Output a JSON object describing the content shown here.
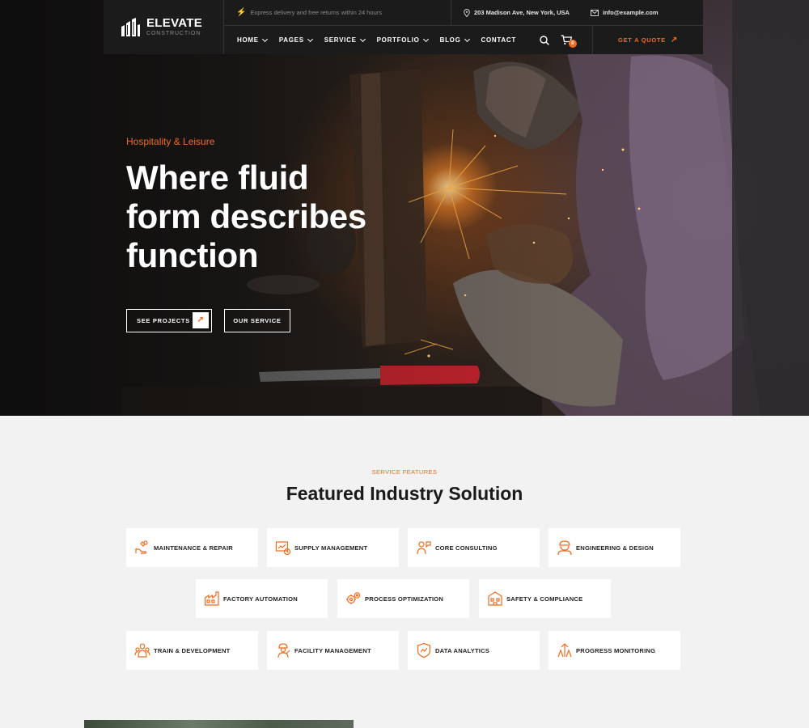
{
  "header": {
    "logo_name": "ELEVATE",
    "logo_sub": "CONSTRUCTION",
    "promo_text": "Express delivery and free returns within 24 hours",
    "address": "203 Madison Ave, New York, USA",
    "email": "info@example.com",
    "nav": [
      {
        "label": "HOME",
        "dropdown": true
      },
      {
        "label": "PAGES",
        "dropdown": true
      },
      {
        "label": "SERVICE",
        "dropdown": true
      },
      {
        "label": "PORTFOLIO",
        "dropdown": true
      },
      {
        "label": "BLOG",
        "dropdown": true
      },
      {
        "label": "CONTACT",
        "dropdown": false
      }
    ],
    "cart_count": "0",
    "quote_label": "GET A QUOTE"
  },
  "hero": {
    "kicker": "Hospitality & Leisure",
    "title_lines": [
      "Where fluid",
      "form describes",
      "function"
    ],
    "btn_projects": "SEE PROJECTS",
    "btn_service": "OUR SERVICE"
  },
  "services": {
    "kicker": "SERVICE FEATURES",
    "title": "Featured Industry Solution",
    "items": [
      {
        "label": "MAINTENANCE & REPAIR",
        "icon": "wrench-hand-icon"
      },
      {
        "label": "SUPPLY MANAGEMENT",
        "icon": "supply-chart-icon"
      },
      {
        "label": "CORE CONSULTING",
        "icon": "consultant-icon"
      },
      {
        "label": "ENGINEERING & DESIGN",
        "icon": "engineer-design-icon"
      },
      {
        "label": "FACTORY AUTOMATION",
        "icon": "factory-icon"
      },
      {
        "label": "PROCESS OPTIMIZATION",
        "icon": "gears-icon"
      },
      {
        "label": "SAFETY & COMPLIANCE",
        "icon": "safety-building-icon"
      },
      {
        "label": "TRAIN & DEVELOPMENT",
        "icon": "training-icon"
      },
      {
        "label": "FACILITY MANAGEMENT",
        "icon": "facility-worker-icon"
      },
      {
        "label": "DATA ANALYTICS",
        "icon": "analytics-shield-icon"
      },
      {
        "label": "PROGRESS MONITORING",
        "icon": "monitoring-icon"
      }
    ]
  },
  "colors": {
    "accent": "#f26b1d",
    "header_bg": "#1b1b1b",
    "section_bg": "#f2f2f2"
  }
}
